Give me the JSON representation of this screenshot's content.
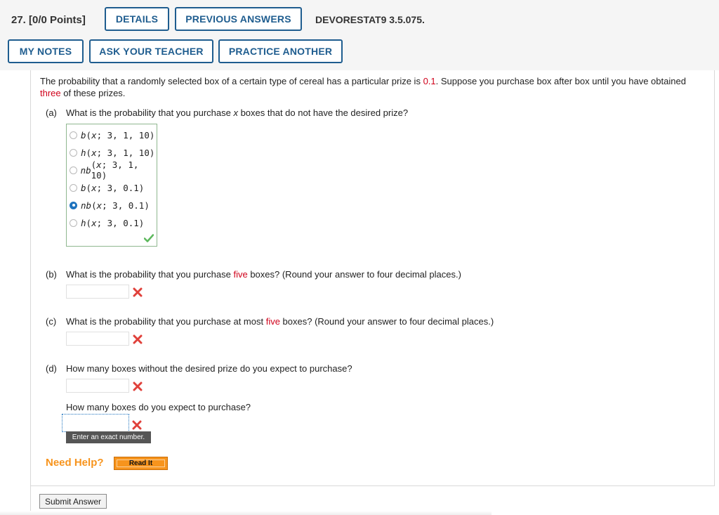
{
  "header": {
    "question_number": "27.",
    "points": "[0/0 Points]",
    "buttons": {
      "details": "DETAILS",
      "previous_answers": "PREVIOUS ANSWERS",
      "my_notes": "MY NOTES",
      "ask_teacher": "ASK YOUR TEACHER",
      "practice_another": "PRACTICE ANOTHER"
    },
    "problem_code": "DEVORESTAT9 3.5.075."
  },
  "problem": {
    "intro_1": "The probability that a randomly selected box of a certain type of cereal has a particular prize is ",
    "prob_value": "0.1",
    "intro_2": ". Suppose you purchase box after box until you have obtained ",
    "count_word": "three",
    "intro_3": " of these prizes."
  },
  "part_a": {
    "label": "(a)",
    "question_1": "What is the probability that you purchase ",
    "question_var": "x",
    "question_2": " boxes that do not have the desired prize?",
    "choices": [
      {
        "fn": "b",
        "args": "(x; 3, 1, 10)",
        "selected": false
      },
      {
        "fn": "h",
        "args": "(x; 3, 1, 10)",
        "selected": false
      },
      {
        "fn": "nb",
        "args": "(x; 3, 1, 10)",
        "selected": false
      },
      {
        "fn": "b",
        "args": "(x; 3, 0.1)",
        "selected": false
      },
      {
        "fn": "nb",
        "args": "(x; 3, 0.1)",
        "selected": true
      },
      {
        "fn": "h",
        "args": "(x; 3, 0.1)",
        "selected": false
      }
    ]
  },
  "part_b": {
    "label": "(b)",
    "question_1": "What is the probability that you purchase ",
    "highlight": "five",
    "question_2": " boxes? (Round your answer to four decimal places.)",
    "answer": ""
  },
  "part_c": {
    "label": "(c)",
    "question_1": "What is the probability that you purchase at most ",
    "highlight": "five",
    "question_2": " boxes? (Round your answer to four decimal places.)",
    "answer": ""
  },
  "part_d": {
    "label": "(d)",
    "question": "How many boxes without the desired prize do you expect to purchase?",
    "answer": "",
    "question_2": "How many boxes do you expect to purchase?",
    "answer_2": "",
    "tooltip": "Enter an exact number."
  },
  "help": {
    "need_help": "Need Help?",
    "read_it": "Read It"
  },
  "submit_label": "Submit Answer",
  "colors": {
    "accent_blue": "#1f5d8f",
    "highlight_red": "#d0021b",
    "help_orange": "#f7941d",
    "correct_green": "#5cb85c",
    "incorrect_red": "#e0403a"
  }
}
